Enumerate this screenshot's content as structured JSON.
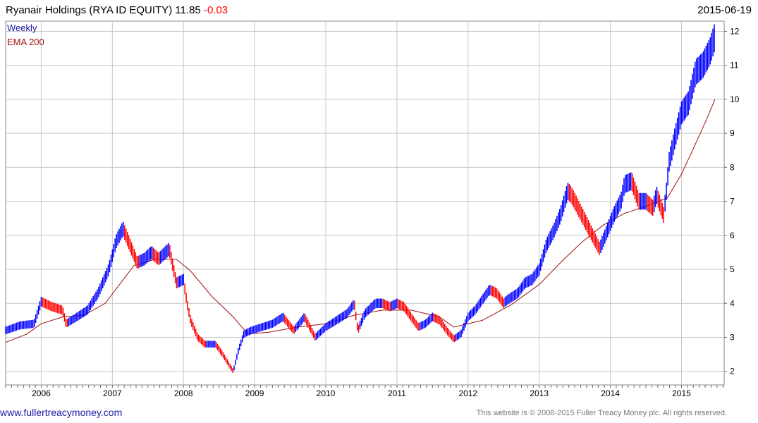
{
  "header": {
    "title": "Ryanair Holdings (RYA ID EQUITY) 11.85",
    "change": "-0.03",
    "date": "2015-06-19"
  },
  "footer": {
    "website": "www.fullertreacymoney.com",
    "copyright": "This website is © 2008-2015 Fuller Treacy Money plc. All rights reserved."
  },
  "colors": {
    "up": "#0000ff",
    "down": "#ff0000",
    "ema": "#a01010",
    "grid": "#c8c8c8"
  },
  "chart_data": {
    "type": "line",
    "y_axis_side": "right",
    "grid": true,
    "legend_position": "top-left",
    "xlim": [
      2005.5,
      2015.6
    ],
    "ylim": [
      1.6,
      12.3
    ],
    "y_ticks": [
      2,
      3,
      4,
      5,
      6,
      7,
      8,
      9,
      10,
      11,
      12
    ],
    "x_ticks": [
      {
        "label": "2006",
        "value": 2006
      },
      {
        "label": "2007",
        "value": 2007
      },
      {
        "label": "2008",
        "value": 2008
      },
      {
        "label": "2009",
        "value": 2009
      },
      {
        "label": "2010",
        "value": 2010
      },
      {
        "label": "2011",
        "value": 2011
      },
      {
        "label": "2012",
        "value": 2012
      },
      {
        "label": "2013",
        "value": 2013
      },
      {
        "label": "2014",
        "value": 2014
      },
      {
        "label": "2015",
        "value": 2015
      }
    ],
    "series": [
      {
        "name": "Weekly",
        "kind": "weekly-range",
        "x": [
          2005.5,
          2005.7,
          2005.9,
          2006.0,
          2006.15,
          2006.3,
          2006.35,
          2006.5,
          2006.65,
          2006.8,
          2006.95,
          2007.05,
          2007.15,
          2007.25,
          2007.35,
          2007.45,
          2007.55,
          2007.65,
          2007.8,
          2007.9,
          2008.0,
          2008.05,
          2008.1,
          2008.2,
          2008.3,
          2008.45,
          2008.55,
          2008.7,
          2008.77,
          2008.85,
          2008.95,
          2009.1,
          2009.25,
          2009.4,
          2009.55,
          2009.7,
          2009.85,
          2010.0,
          2010.15,
          2010.3,
          2010.4,
          2010.45,
          2010.55,
          2010.7,
          2010.8,
          2010.9,
          2011.0,
          2011.1,
          2011.2,
          2011.3,
          2011.4,
          2011.5,
          2011.6,
          2011.7,
          2011.8,
          2011.9,
          2012.0,
          2012.1,
          2012.2,
          2012.3,
          2012.4,
          2012.5,
          2012.55,
          2012.7,
          2012.8,
          2012.9,
          2013.0,
          2013.1,
          2013.2,
          2013.3,
          2013.4,
          2013.45,
          2013.55,
          2013.65,
          2013.75,
          2013.85,
          2013.95,
          2014.05,
          2014.15,
          2014.2,
          2014.3,
          2014.4,
          2014.5,
          2014.6,
          2014.65,
          2014.75,
          2014.8,
          2014.82,
          2014.9,
          2015.0,
          2015.1,
          2015.2,
          2015.3,
          2015.4,
          2015.47
        ],
        "values": [
          3.2,
          3.35,
          3.4,
          4.05,
          3.9,
          3.8,
          3.4,
          3.6,
          3.8,
          4.3,
          5.0,
          5.8,
          6.2,
          5.7,
          5.2,
          5.3,
          5.5,
          5.3,
          5.6,
          4.6,
          4.7,
          4.0,
          3.5,
          3.0,
          2.8,
          2.8,
          2.5,
          2.0,
          2.6,
          3.1,
          3.2,
          3.3,
          3.4,
          3.6,
          3.2,
          3.6,
          3.0,
          3.3,
          3.5,
          3.7,
          4.0,
          3.2,
          3.7,
          4.0,
          4.0,
          3.9,
          4.0,
          3.9,
          3.6,
          3.3,
          3.4,
          3.6,
          3.5,
          3.2,
          2.95,
          3.1,
          3.6,
          3.8,
          4.1,
          4.4,
          4.3,
          4.0,
          4.1,
          4.3,
          4.6,
          4.7,
          5.0,
          5.7,
          6.1,
          6.6,
          7.3,
          7.2,
          6.8,
          6.4,
          6.0,
          5.6,
          6.1,
          6.6,
          7.0,
          7.5,
          7.6,
          7.0,
          7.0,
          6.8,
          7.2,
          6.6,
          7.5,
          8.1,
          8.8,
          9.6,
          9.9,
          10.8,
          11.0,
          11.4,
          11.85
        ]
      },
      {
        "name": "EMA 200",
        "kind": "line",
        "x": [
          2005.5,
          2005.8,
          2006.0,
          2006.3,
          2006.6,
          2006.9,
          2007.1,
          2007.3,
          2007.6,
          2007.9,
          2008.1,
          2008.4,
          2008.7,
          2008.9,
          2009.2,
          2009.6,
          2010.0,
          2010.4,
          2010.8,
          2011.2,
          2011.6,
          2011.8,
          2012.2,
          2012.6,
          2013.0,
          2013.3,
          2013.6,
          2013.9,
          2014.2,
          2014.5,
          2014.8,
          2015.0,
          2015.2,
          2015.35,
          2015.47
        ],
        "values": [
          2.85,
          3.1,
          3.4,
          3.6,
          3.65,
          4.0,
          4.55,
          5.1,
          5.3,
          5.3,
          4.95,
          4.2,
          3.6,
          3.1,
          3.15,
          3.3,
          3.4,
          3.65,
          3.8,
          3.8,
          3.6,
          3.3,
          3.5,
          3.95,
          4.55,
          5.2,
          5.8,
          6.3,
          6.65,
          6.85,
          7.1,
          7.8,
          8.7,
          9.4,
          10.0
        ]
      }
    ]
  }
}
